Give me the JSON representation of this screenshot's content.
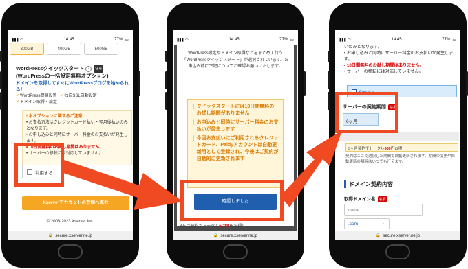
{
  "status": {
    "time": "14:45",
    "battery": "77%"
  },
  "url": "secure.xserver.ne.jp",
  "phone1": {
    "plans": [
      {
        "top": "",
        "value": "300GB",
        "selected": true
      },
      {
        "top": "",
        "value": "400GB",
        "selected": false
      },
      {
        "top": "",
        "value": "500GB",
        "selected": false
      }
    ],
    "title_line1": "WordPressクイックスタート",
    "help": "?",
    "tag": "任意",
    "title_line2": "(WordPressの一括設定無料オプション)",
    "promo": "ドメインを取得してすぐにWordPressブログを始められる！",
    "checks": [
      "WordPress簡易設置",
      "独自SSL自動設定",
      "ドメイン取得・設定"
    ],
    "note_header": "本オプションに関するご注意：",
    "note_items": [
      "お支払方法はクレジットカード払い・翌月後払いのみとなります。",
      "お申し込みと同時にサーバー料金のお支払いが発生します。",
      "10日間無料のお試し期間はありません。",
      "サーバーの移転には対応していません。"
    ],
    "use_label": "利用する",
    "submit": "Xserverアカウントの登録へ進む",
    "footer": "© 2003-2023 Xserver Inc."
  },
  "phone2": {
    "intro": "WordPress設定やドメイン取得などをまとめて行う「WordPressクイックスタート」が選択されています。お申込み前に下記についてご確認お願いいたします。",
    "warnings": [
      "クイックスタートには10日間無料のお試し期間がありません",
      "お申込みと同時にサーバー料金のお支払いが発生します",
      "今回お支払いにご利用されるクレジットカード、Paidyアカウントは自動更新用として登録され、今後はご契約が自動的に更新されます"
    ],
    "confirm": "確認しました",
    "bottom_prefix": "3ヶ月契約でトータル",
    "bottom_price": "5,280",
    "bottom_suffix": "円お得！"
  },
  "phone3": {
    "items": [
      "いのみとなります。",
      "お申し込みと同時にサーバー料金のお支払いが発生します。",
      "10日間無料のお試し期間はありません。",
      "サーバーの移転には対応していません。"
    ],
    "use_label": "利用する",
    "period_label": "サーバーの契約期間",
    "required": "必須",
    "period_value": "6ヶ月",
    "price_prefix": "3ヶ月契約でトータル",
    "price": "660",
    "price_suffix": "円お得！",
    "note": "契約はここで選択した期間で自動更新されます。期間の変更や自動更新の解除はいつでも行えます。",
    "domain_heading": "ドメイン契約内容",
    "domain_label": "取得ドメイン名",
    "name_placeholder": "name",
    "tld": ".com"
  },
  "colors": {
    "highlight": "#f04a23",
    "orange": "#f5a623",
    "blue": "#1f5fae",
    "red": "#d40000"
  }
}
